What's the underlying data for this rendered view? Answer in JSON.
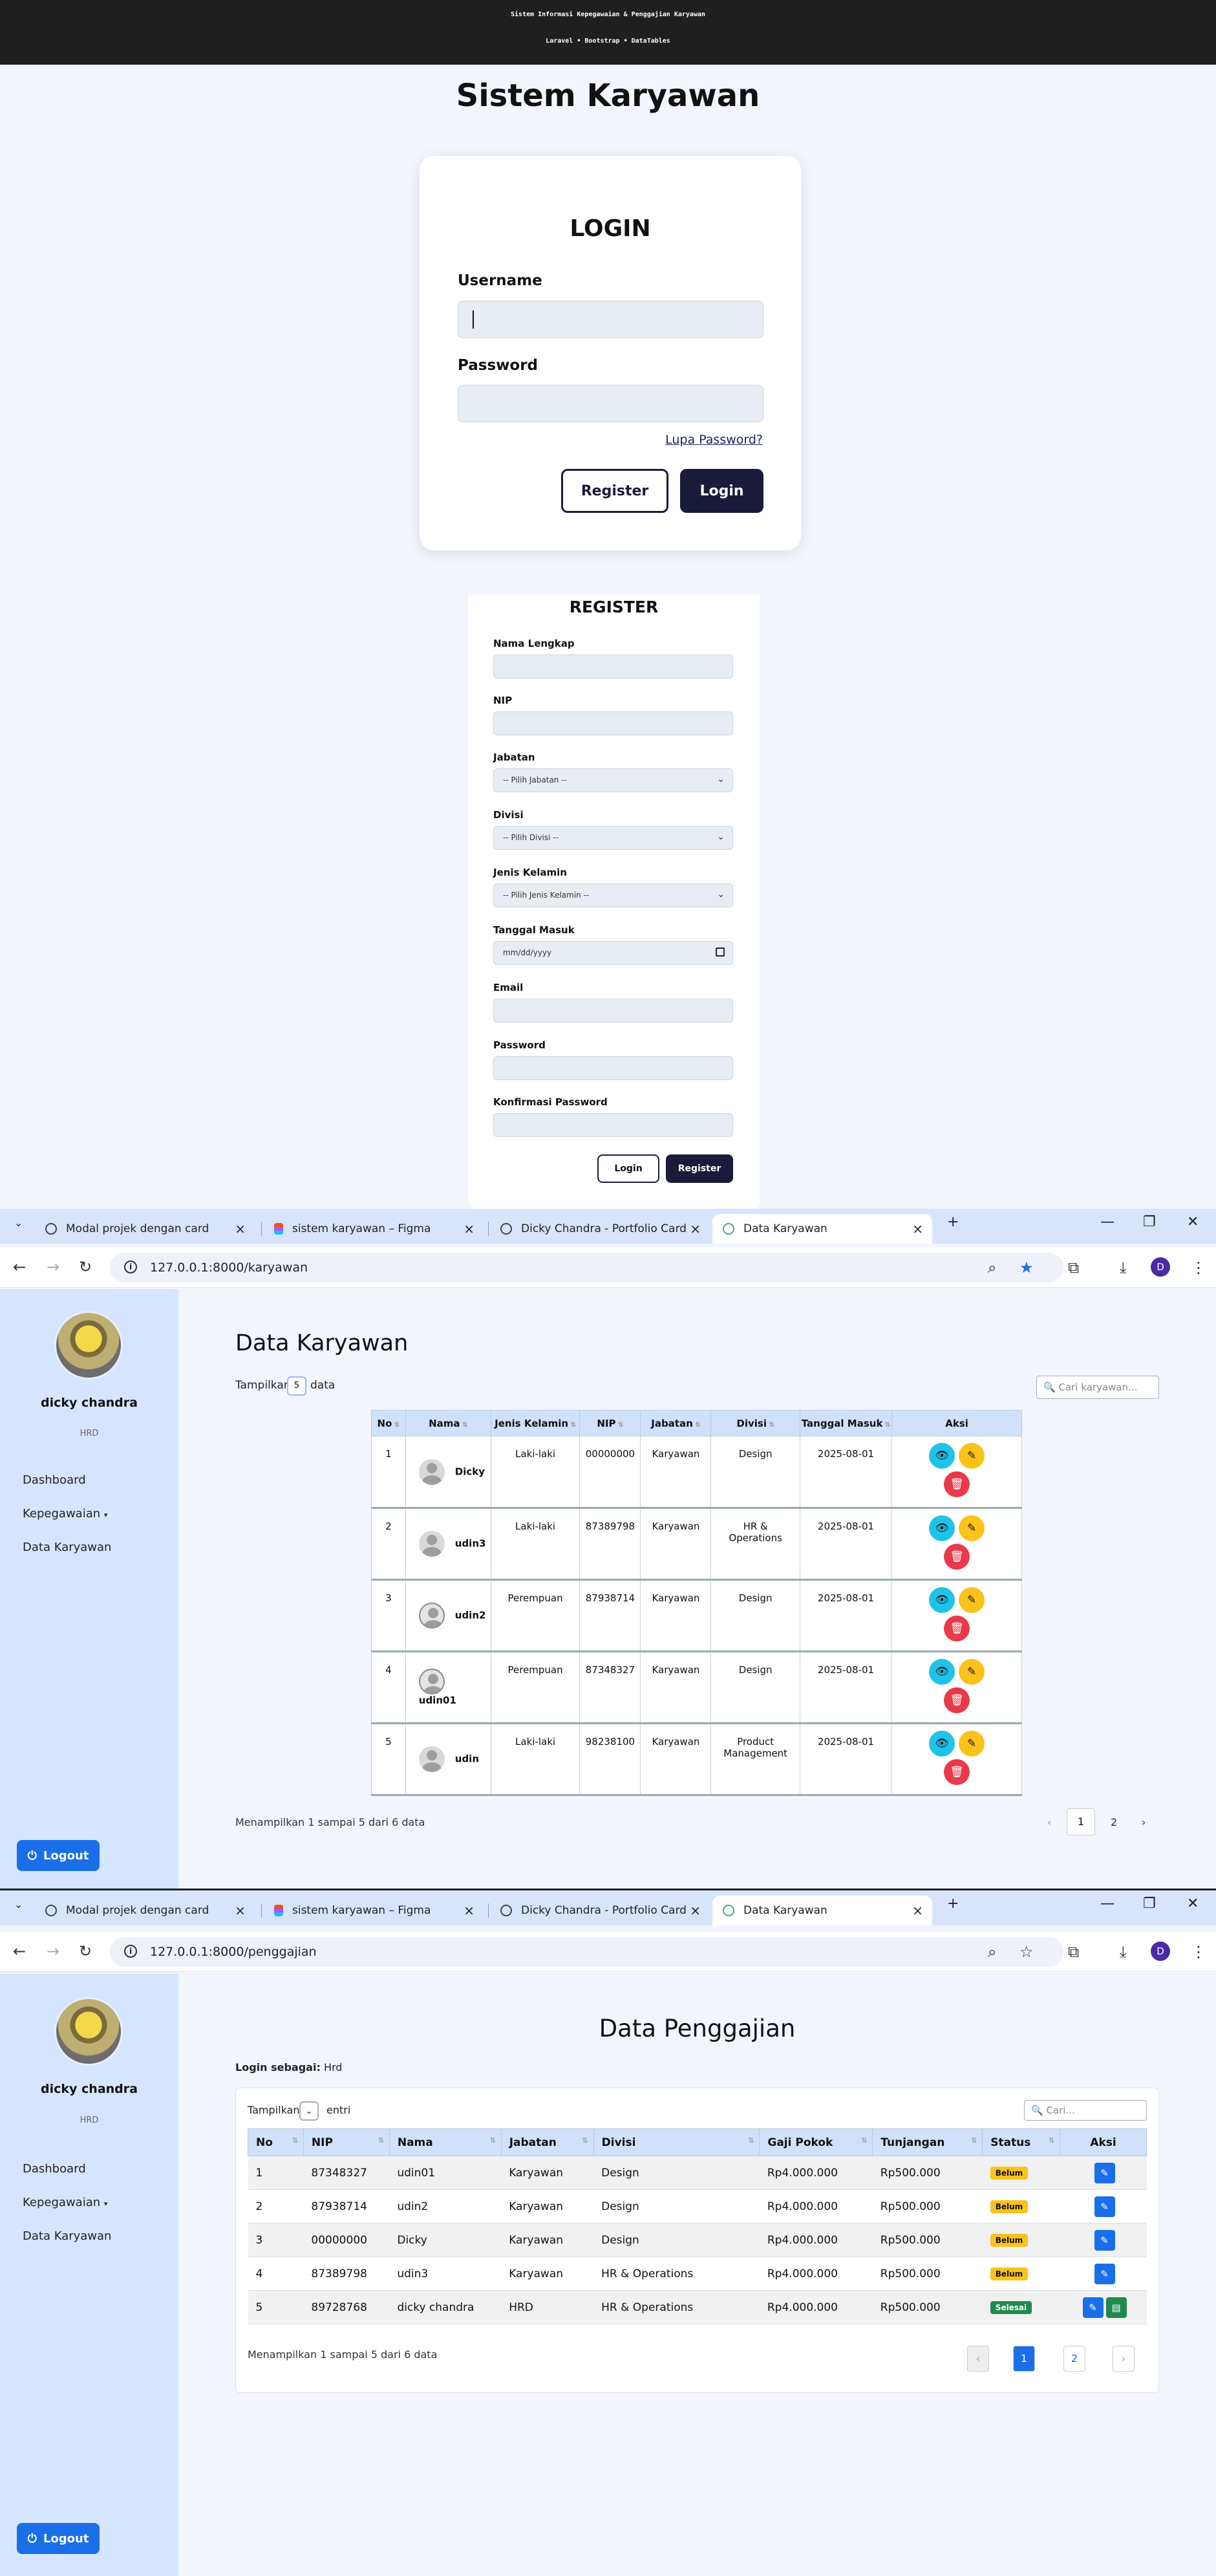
{
  "login_page": {
    "header_line1": "Sistem Informasi Kepegawaian & Penggajian Karyawan",
    "header_line2": "Laravel • Bootstrap • DataTables",
    "title": "Sistem Karyawan",
    "card_title": "LOGIN",
    "username_label": "Username",
    "password_label": "Password",
    "forgot_link": "Lupa Password?",
    "register_button": "Register",
    "login_button": "Login"
  },
  "register_form": {
    "title": "REGISTER",
    "fields": [
      {
        "label": "Nama Lengkap",
        "value": ""
      },
      {
        "label": "NIP",
        "value": ""
      },
      {
        "label": "Jabatan",
        "value": "-- Pilih Jabatan --",
        "type": "select"
      },
      {
        "label": "Divisi",
        "value": "-- Pilih Divisi --",
        "type": "select"
      },
      {
        "label": "Jenis Kelamin",
        "value": "-- Pilih Jenis Kelamin --",
        "type": "select"
      },
      {
        "label": "Tanggal Masuk",
        "value": "mm/dd/yyyy",
        "type": "date"
      },
      {
        "label": "Email",
        "value": ""
      },
      {
        "label": "Password",
        "value": ""
      },
      {
        "label": "Konfirmasi Password",
        "value": ""
      }
    ],
    "login_button": "Login",
    "register_button": "Register"
  },
  "browser": {
    "tabs": [
      {
        "label": "Modal projek dengan card"
      },
      {
        "label": "sistem karyawan – Figma"
      },
      {
        "label": "Dicky Chandra - Portfolio Card"
      },
      {
        "label": "Data Karyawan"
      }
    ],
    "url_karyawan": "127.0.0.1:8000/karyawan",
    "url_penggajian": "127.0.0.1:8000/penggajian",
    "profile_letter": "D"
  },
  "sidebar": {
    "name": "dicky chandra",
    "role": "HRD",
    "items": [
      {
        "label": "Dashboard"
      },
      {
        "label": "Kepegawaian"
      },
      {
        "label": "Data Karyawan"
      }
    ],
    "logout": "Logout"
  },
  "karyawan": {
    "title": "Data Karyawan",
    "show_prefix": "Tampilkan",
    "show_value": "5",
    "show_suffix": "data",
    "search_placeholder": "Cari karyawan...",
    "columns": [
      "No",
      "Nama",
      "Jenis Kelamin",
      "NIP",
      "Jabatan",
      "Divisi",
      "Tanggal Masuk",
      "Aksi"
    ],
    "rows": [
      {
        "no": "1",
        "nama": "Dicky",
        "jk": "Laki-laki",
        "nip": "00000000",
        "jabatan": "Karyawan",
        "divisi": "Design",
        "tgl": "2025-08-01",
        "avatar": "male"
      },
      {
        "no": "2",
        "nama": "udin3",
        "jk": "Laki-laki",
        "nip": "87389798",
        "jabatan": "Karyawan",
        "divisi": "HR & Operations",
        "tgl": "2025-08-01",
        "avatar": "male"
      },
      {
        "no": "3",
        "nama": "udin2",
        "jk": "Perempuan",
        "nip": "87938714",
        "jabatan": "Karyawan",
        "divisi": "Design",
        "tgl": "2025-08-01",
        "avatar": "female"
      },
      {
        "no": "4",
        "nama": "udin01",
        "jk": "Perempuan",
        "nip": "87348327",
        "jabatan": "Karyawan",
        "divisi": "Design",
        "tgl": "2025-08-01",
        "avatar": "female"
      },
      {
        "no": "5",
        "nama": "udin",
        "jk": "Laki-laki",
        "nip": "98238100",
        "jabatan": "Karyawan",
        "divisi": "Product Management",
        "tgl": "2025-08-01",
        "avatar": "male"
      }
    ],
    "info": "Menampilkan 1 sampai 5 dari 6 data",
    "pages": [
      "‹",
      "1",
      "2",
      "›"
    ]
  },
  "penggajian": {
    "title": "Data Penggajian",
    "login_as_label": "Login sebagai:",
    "login_as_value": "Hrd",
    "show_prefix": "Tampilkan",
    "show_suffix": "entri",
    "search_placeholder": "Cari...",
    "columns": [
      "No",
      "NIP",
      "Nama",
      "Jabatan",
      "Divisi",
      "Gaji Pokok",
      "Tunjangan",
      "Status",
      "Aksi"
    ],
    "rows": [
      {
        "no": "1",
        "nip": "87348327",
        "nama": "udin01",
        "jabatan": "Karyawan",
        "divisi": "Design",
        "gaji": "Rp4.000.000",
        "tunjangan": "Rp500.000",
        "status": "Belum"
      },
      {
        "no": "2",
        "nip": "87938714",
        "nama": "udin2",
        "jabatan": "Karyawan",
        "divisi": "Design",
        "gaji": "Rp4.000.000",
        "tunjangan": "Rp500.000",
        "status": "Belum"
      },
      {
        "no": "3",
        "nip": "00000000",
        "nama": "Dicky",
        "jabatan": "Karyawan",
        "divisi": "Design",
        "gaji": "Rp4.000.000",
        "tunjangan": "Rp500.000",
        "status": "Belum"
      },
      {
        "no": "4",
        "nip": "87389798",
        "nama": "udin3",
        "jabatan": "Karyawan",
        "divisi": "HR & Operations",
        "gaji": "Rp4.000.000",
        "tunjangan": "Rp500.000",
        "status": "Belum"
      },
      {
        "no": "5",
        "nip": "89728768",
        "nama": "dicky chandra",
        "jabatan": "HRD",
        "divisi": "HR & Operations",
        "gaji": "Rp4.000.000",
        "tunjangan": "Rp500.000",
        "status": "Selesai"
      }
    ],
    "info": "Menampilkan 1 sampai 5 dari 6 data",
    "pages": [
      "‹",
      "1",
      "2",
      "›"
    ]
  },
  "colors": {
    "navy": "#1a1a3a",
    "primary": "#1a6fe8",
    "sidebar": "#d6e5ff",
    "warning": "#fbc21a",
    "success": "#1f8a4c",
    "danger": "#e83a4a",
    "info": "#1fc3e8"
  }
}
